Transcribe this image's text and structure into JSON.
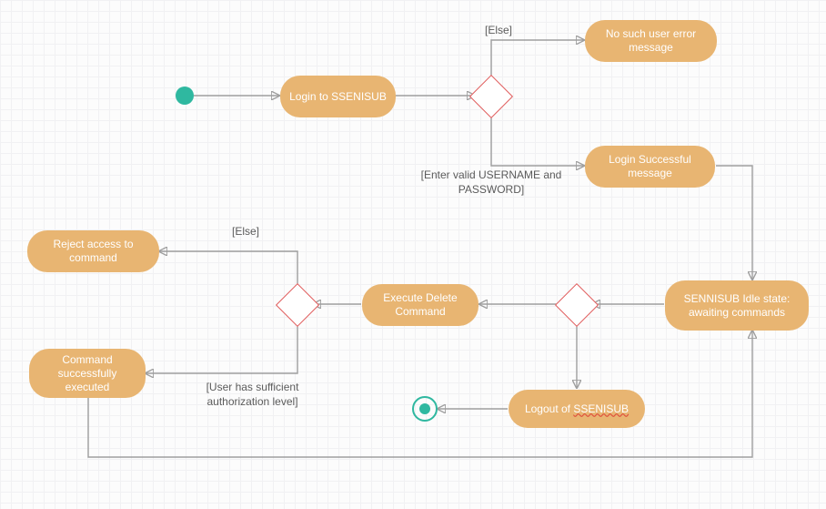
{
  "diagram": {
    "type": "UML Activity Diagram",
    "nodes": {
      "login": {
        "label": "Login to SSENISUB"
      },
      "noUserError": {
        "label": "No such user error message"
      },
      "loginSuccess": {
        "label": "Login Successful message"
      },
      "idleState": {
        "label": "SENNISUB Idle state: awaiting commands"
      },
      "executeDelete": {
        "label": "Execute Delete Command"
      },
      "rejectAccess": {
        "label": "Reject access to command"
      },
      "commandExecuted": {
        "label": "Command successfully executed"
      },
      "logout": {
        "label_pre": "Logout of ",
        "label_wavy": "SSENISUB"
      }
    },
    "guards": {
      "else1": "[Else]",
      "validCreds": "[Enter valid USERNAME and PASSWORD]",
      "else2": "[Else]",
      "sufficientAuth": "[User has sufficient authorization level]"
    },
    "colors": {
      "activityFill": "#e8b572",
      "initialFinal": "#2fb8a0",
      "decisionBorder": "#e05a5a",
      "edge": "#9e9e9e"
    }
  }
}
